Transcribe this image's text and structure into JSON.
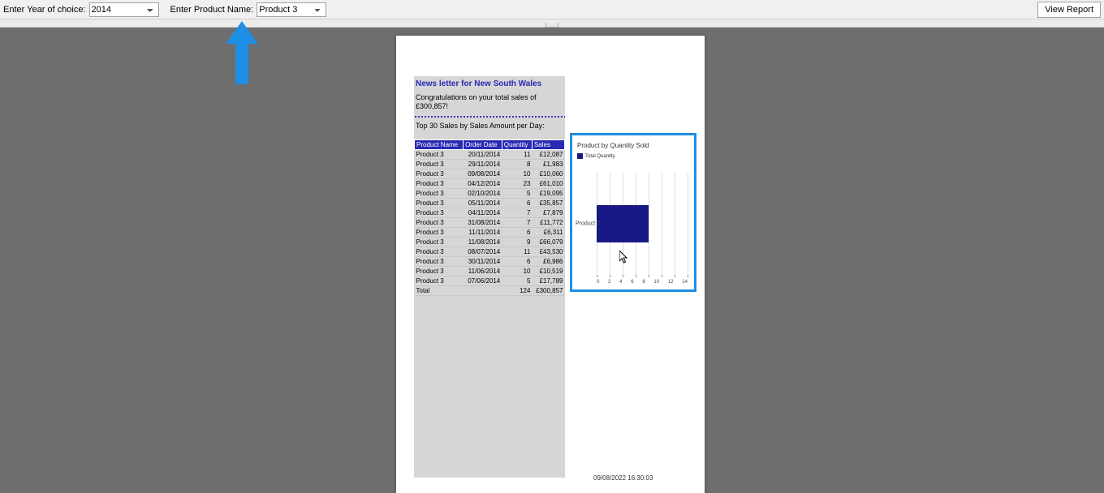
{
  "params": {
    "year_label": "Enter Year of choice:",
    "year_value": "2014",
    "product_label": "Enter Product Name:",
    "product_value": "Product 3",
    "view_report": "View Report"
  },
  "report": {
    "title": "News letter for New South Wales",
    "congrats": "Congratulations on your total sales of £300,857!",
    "subtitle": "Top 30 Sales by Sales Amount per Day:",
    "headers": {
      "product": "Product Name",
      "date": "Order Date",
      "qty": "Quantity",
      "sales": "Sales"
    },
    "rows": [
      {
        "product": "Product 3",
        "date": "20/11/2014",
        "qty": "11",
        "sales": "£12,087"
      },
      {
        "product": "Product 3",
        "date": "29/11/2014",
        "qty": "8",
        "sales": "£1,983"
      },
      {
        "product": "Product 3",
        "date": "09/08/2014",
        "qty": "10",
        "sales": "£10,060"
      },
      {
        "product": "Product 3",
        "date": "04/12/2014",
        "qty": "23",
        "sales": "£61,010"
      },
      {
        "product": "Product 3",
        "date": "02/10/2014",
        "qty": "5",
        "sales": "£19,095"
      },
      {
        "product": "Product 3",
        "date": "05/11/2014",
        "qty": "6",
        "sales": "£35,857"
      },
      {
        "product": "Product 3",
        "date": "04/11/2014",
        "qty": "7",
        "sales": "£7,879"
      },
      {
        "product": "Product 3",
        "date": "31/08/2014",
        "qty": "7",
        "sales": "£11,772"
      },
      {
        "product": "Product 3",
        "date": "11/11/2014",
        "qty": "6",
        "sales": "£6,311"
      },
      {
        "product": "Product 3",
        "date": "11/08/2014",
        "qty": "9",
        "sales": "£66,079"
      },
      {
        "product": "Product 3",
        "date": "08/07/2014",
        "qty": "11",
        "sales": "£43,530"
      },
      {
        "product": "Product 3",
        "date": "30/11/2014",
        "qty": "6",
        "sales": "£6,986"
      },
      {
        "product": "Product 3",
        "date": "11/06/2014",
        "qty": "10",
        "sales": "£10,519"
      },
      {
        "product": "Product 3",
        "date": "07/06/2014",
        "qty": "5",
        "sales": "£17,789"
      }
    ],
    "total": {
      "label": "Total",
      "qty": "124",
      "sales": "£300,857"
    },
    "timestamp": "09/08/2022 16:30:03"
  },
  "chart_data": {
    "type": "bar",
    "orientation": "horizontal",
    "title": "Product by Quantity Sold",
    "legend": "Total Quantity",
    "categories": [
      "Product 3"
    ],
    "values": [
      8
    ],
    "xticks": [
      "0",
      "2",
      "4",
      "6",
      "8",
      "10",
      "12",
      "14"
    ],
    "xlim": [
      0,
      14
    ]
  }
}
